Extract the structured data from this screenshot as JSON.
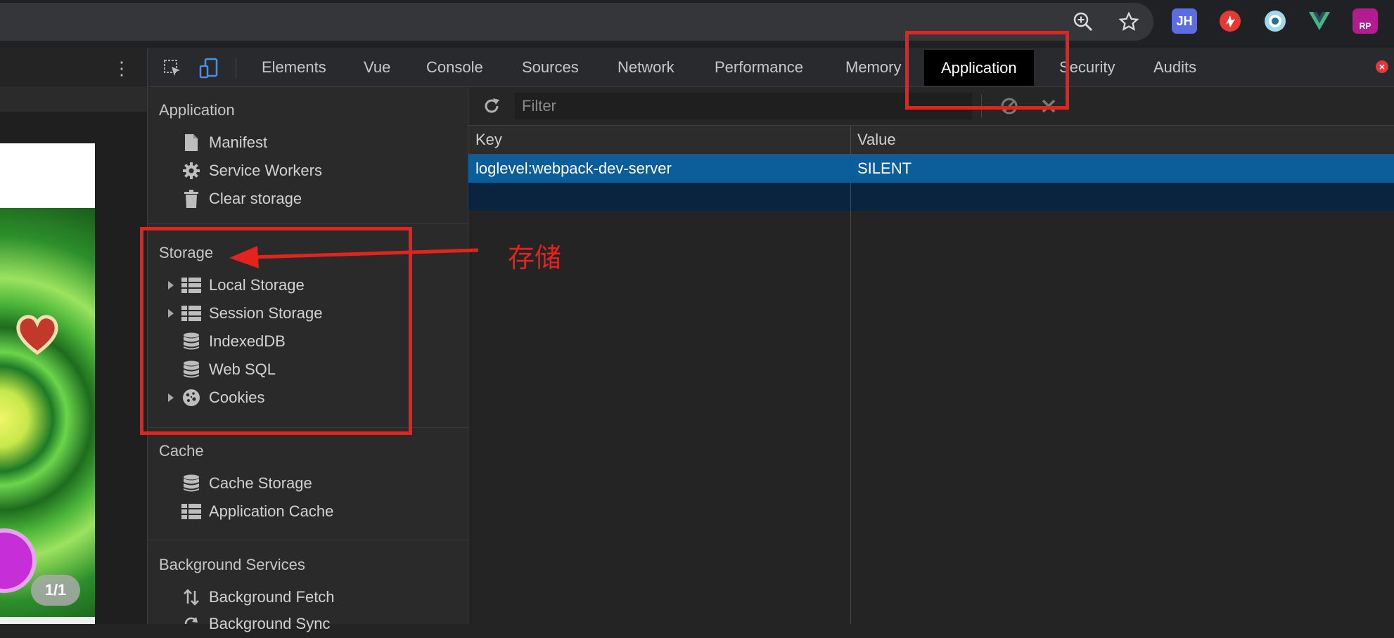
{
  "browser": {
    "zoom_icon": "zoom-in-icon",
    "bookmark_icon": "star-icon",
    "extensions": [
      {
        "name": "jh-extension",
        "label": "JH",
        "color": "#5b6ee1"
      },
      {
        "name": "red-extension",
        "label": "",
        "color": "#e53935"
      },
      {
        "name": "eye-extension",
        "label": "",
        "color": "#4fc3f7"
      },
      {
        "name": "vue-devtools-extension",
        "label": "V",
        "color": "#41b883"
      },
      {
        "name": "rp-extension",
        "label": "RP",
        "color": "#b31b91"
      }
    ]
  },
  "page_preview": {
    "counter": "1/1"
  },
  "devtools": {
    "tabs": [
      {
        "id": "elements",
        "label": "Elements"
      },
      {
        "id": "vue",
        "label": "Vue"
      },
      {
        "id": "console",
        "label": "Console"
      },
      {
        "id": "sources",
        "label": "Sources"
      },
      {
        "id": "network",
        "label": "Network"
      },
      {
        "id": "performance",
        "label": "Performance"
      },
      {
        "id": "memory",
        "label": "Memory"
      },
      {
        "id": "application",
        "label": "Application",
        "active": true
      },
      {
        "id": "security",
        "label": "Security"
      },
      {
        "id": "audits",
        "label": "Audits"
      }
    ],
    "error_badge": "×",
    "sidebar": {
      "application": {
        "title": "Application",
        "items": [
          {
            "label": "Manifest",
            "icon": "document-icon"
          },
          {
            "label": "Service Workers",
            "icon": "gear-icon"
          },
          {
            "label": "Clear storage",
            "icon": "trash-icon"
          }
        ]
      },
      "storage": {
        "title": "Storage",
        "items": [
          {
            "label": "Local Storage",
            "icon": "table-icon",
            "expandable": true
          },
          {
            "label": "Session Storage",
            "icon": "table-icon",
            "expandable": true
          },
          {
            "label": "IndexedDB",
            "icon": "database-icon"
          },
          {
            "label": "Web SQL",
            "icon": "database-icon"
          },
          {
            "label": "Cookies",
            "icon": "cookie-icon",
            "expandable": true
          }
        ]
      },
      "cache": {
        "title": "Cache",
        "items": [
          {
            "label": "Cache Storage",
            "icon": "database-icon"
          },
          {
            "label": "Application Cache",
            "icon": "table-icon"
          }
        ]
      },
      "background": {
        "title": "Background Services",
        "items": [
          {
            "label": "Background Fetch",
            "icon": "updown-arrows-icon"
          },
          {
            "label": "Background Sync",
            "icon": "sync-icon"
          }
        ]
      }
    },
    "main": {
      "filter_placeholder": "Filter",
      "columns": {
        "key": "Key",
        "value": "Value"
      },
      "rows": [
        {
          "key": "loglevel:webpack-dev-server",
          "value": "SILENT",
          "selected": true
        }
      ]
    }
  },
  "annotation": {
    "label": "存储",
    "color": "#e3231d"
  }
}
